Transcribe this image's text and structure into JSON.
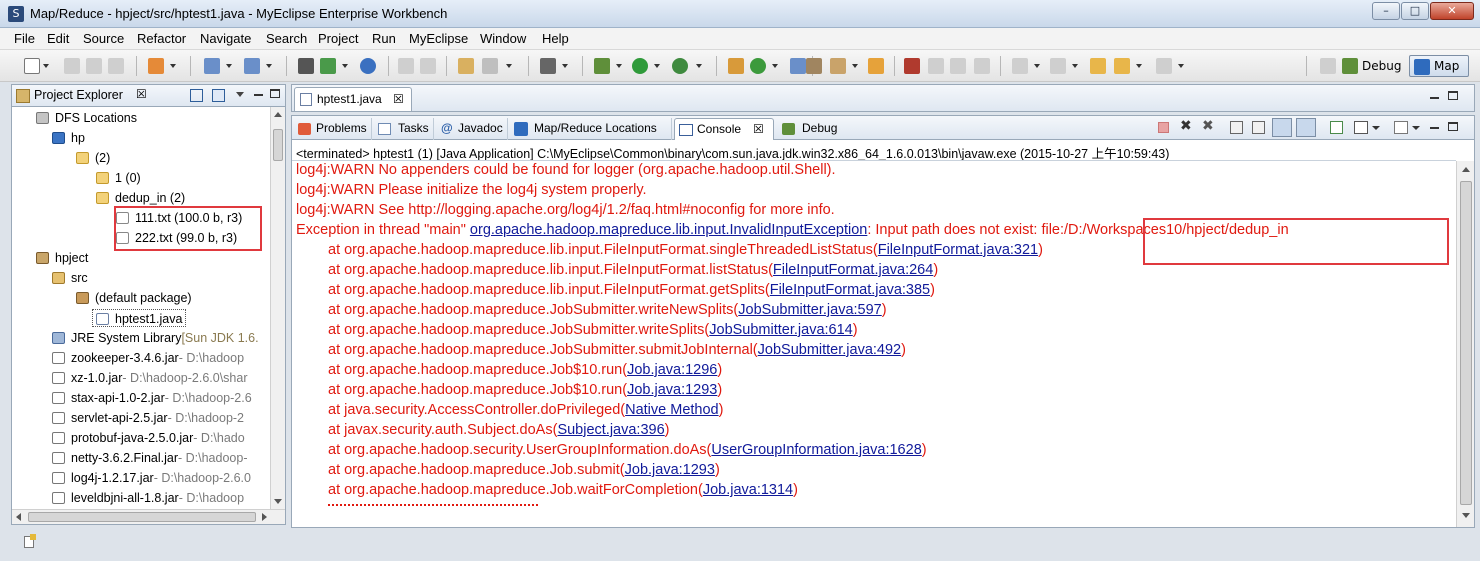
{
  "window": {
    "title": "Map/Reduce - hpject/src/hptest1.java - MyEclipse Enterprise Workbench",
    "logo": "myeclipse-logo-icon",
    "min": "–",
    "max": "□",
    "close": "✕"
  },
  "menu": [
    "File",
    "Edit",
    "Source",
    "Refactor",
    "Navigate",
    "Search",
    "Project",
    "Run",
    "MyEclipse",
    "Window",
    "Help"
  ],
  "perspectives": {
    "debug": "Debug",
    "mapreduce": "Map"
  },
  "explorer": {
    "tab": "Project Explorer",
    "close": "☒",
    "items": [
      {
        "label": "DFS Locations",
        "extra": "",
        "icon": "dfs-locations-icon"
      },
      {
        "label": "hp",
        "extra": "",
        "icon": "hadoop-location-icon"
      },
      {
        "label": "(2)",
        "extra": "",
        "icon": "folder-icon"
      },
      {
        "label": "1 (0)",
        "extra": "",
        "icon": "folder-icon"
      },
      {
        "label": "dedup_in (2)",
        "extra": "",
        "icon": "folder-icon"
      },
      {
        "label": "111.txt (100.0 b, r3)",
        "extra": "",
        "icon": "file-icon"
      },
      {
        "label": "222.txt (99.0 b, r3)",
        "extra": "",
        "icon": "file-icon"
      },
      {
        "label": "hpject",
        "extra": "",
        "icon": "project-icon"
      },
      {
        "label": "src",
        "extra": "",
        "icon": "source-folder-icon"
      },
      {
        "label": "(default package)",
        "extra": "",
        "icon": "package-icon"
      },
      {
        "label": "hptest1.java",
        "extra": "",
        "icon": "java-file-icon"
      },
      {
        "label": "JRE System Library",
        "extra": "[Sun JDK 1.6.",
        "icon": "library-icon"
      },
      {
        "label": "zookeeper-3.4.6.jar",
        "extra": " - D:\\hadoop",
        "icon": "jar-icon"
      },
      {
        "label": "xz-1.0.jar",
        "extra": " - D:\\hadoop-2.6.0\\shar",
        "icon": "jar-icon"
      },
      {
        "label": "stax-api-1.0-2.jar",
        "extra": " - D:\\hadoop-2.6",
        "icon": "jar-icon"
      },
      {
        "label": "servlet-api-2.5.jar",
        "extra": " - D:\\hadoop-2",
        "icon": "jar-icon"
      },
      {
        "label": "protobuf-java-2.5.0.jar",
        "extra": " - D:\\hado",
        "icon": "jar-icon"
      },
      {
        "label": "netty-3.6.2.Final.jar",
        "extra": " - D:\\hadoop-",
        "icon": "jar-icon"
      },
      {
        "label": "log4j-1.2.17.jar",
        "extra": " - D:\\hadoop-2.6.0",
        "icon": "jar-icon"
      },
      {
        "label": "leveldbjni-all-1.8.jar",
        "extra": " - D:\\hadoop",
        "icon": "jar-icon"
      }
    ]
  },
  "editor": {
    "tab": "hptest1.java",
    "close": "☒"
  },
  "console": {
    "tabs": [
      "Problems",
      "Tasks",
      "Javadoc",
      "Map/Reduce Locations",
      "Console",
      "Debug"
    ],
    "active_tab": "Console",
    "header": "<terminated> hptest1 (1) [Java Application] C:\\MyEclipse\\Common\\binary\\com.sun.java.jdk.win32.x86_64_1.6.0.013\\bin\\javaw.exe (2015-10-27 上午10:59:43)",
    "warn1": "log4j:WARN No appenders could be found for logger (org.apache.hadoop.util.Shell).",
    "warn2": "log4j:WARN Please initialize the log4j system properly.",
    "warn3": "log4j:WARN See http://logging.apache.org/log4j/1.2/faq.html#noconfig for more info.",
    "exc_prefix": "Exception in thread \"main\" ",
    "exc_class": "org.apache.hadoop.mapreduce.lib.input.InvalidInputException",
    "exc_msg": ": Input path does not exist: file:/D:/Workspaces10/hpject/dedup_in",
    "frames": [
      {
        "method": "at org.apache.hadoop.mapreduce.lib.input.FileInputFormat.singleThreadedListStatus(",
        "loc": "FileInputFormat.java:321"
      },
      {
        "method": "at org.apache.hadoop.mapreduce.lib.input.FileInputFormat.listStatus(",
        "loc": "FileInputFormat.java:264"
      },
      {
        "method": "at org.apache.hadoop.mapreduce.lib.input.FileInputFormat.getSplits(",
        "loc": "FileInputFormat.java:385"
      },
      {
        "method": "at org.apache.hadoop.mapreduce.JobSubmitter.writeNewSplits(",
        "loc": "JobSubmitter.java:597"
      },
      {
        "method": "at org.apache.hadoop.mapreduce.JobSubmitter.writeSplits(",
        "loc": "JobSubmitter.java:614"
      },
      {
        "method": "at org.apache.hadoop.mapreduce.JobSubmitter.submitJobInternal(",
        "loc": "JobSubmitter.java:492"
      },
      {
        "method": "at org.apache.hadoop.mapreduce.Job$10.run(",
        "loc": "Job.java:1296"
      },
      {
        "method": "at org.apache.hadoop.mapreduce.Job$10.run(",
        "loc": "Job.java:1293"
      },
      {
        "method": "at java.security.AccessController.doPrivileged(",
        "loc": "Native Method"
      },
      {
        "method": "at javax.security.auth.Subject.doAs(",
        "loc": "Subject.java:396"
      },
      {
        "method": "at org.apache.hadoop.security.UserGroupInformation.doAs(",
        "loc": "UserGroupInformation.java:1628"
      },
      {
        "method": "at org.apache.hadoop.mapreduce.Job.submit(",
        "loc": "Job.java:1293"
      },
      {
        "method": "at org.apache.hadoop.mapreduce.Job.waitForCompletion(",
        "loc": "Job.java:1314"
      }
    ],
    "close_paren": ")",
    "text_color": "#e0190f",
    "link_color": "#101a9a"
  },
  "colors": {
    "highlight_box": "#e0393e",
    "panel_border": "#99a8b8"
  }
}
